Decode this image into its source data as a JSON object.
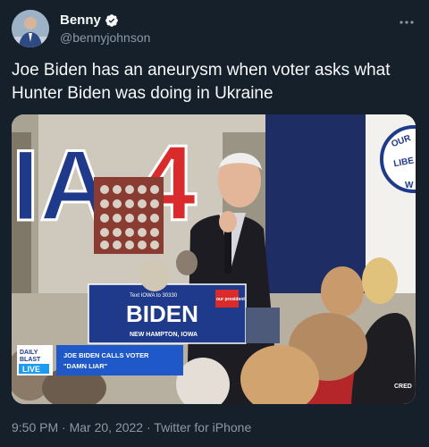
{
  "author": {
    "display_name": "Benny",
    "handle": "@bennyjohnson",
    "verified": true,
    "avatar_icon": "profile-photo"
  },
  "menu_icon": "more-icon",
  "tweet": {
    "text": "Joe Biden has an aneurysm when voter asks what Hunter Biden was doing in Ukraine"
  },
  "media": {
    "banner_letters": "IA",
    "banner_number": "4",
    "podium_small_text": "Text IOWA to 30330",
    "podium_title": "BIDEN",
    "podium_location": "NEW HAMPTON, IOWA",
    "podium_badge": "our president",
    "chyron_logo_line1": "DAILY",
    "chyron_logo_line2": "BLAST",
    "chyron_logo_live": "LIVE",
    "chyron_line1": "JOE BIDEN CALLS VOTER",
    "chyron_line2": "\"DAMN LIAR\"",
    "corner_text": "CRED",
    "sign_text_1": "OUR",
    "sign_text_2": "LIBE",
    "sign_text_3": "W"
  },
  "footer": {
    "time": "9:50 PM",
    "date": "Mar 20, 2022",
    "source": "Twitter for iPhone",
    "separator": "·"
  },
  "colors": {
    "background": "#15202b",
    "text_primary": "#f7f9f9",
    "text_secondary": "#8b98a5",
    "verified_blue": "#1d9bf0",
    "banner_navy": "#1f3a8a",
    "banner_red": "#d92b2b"
  }
}
